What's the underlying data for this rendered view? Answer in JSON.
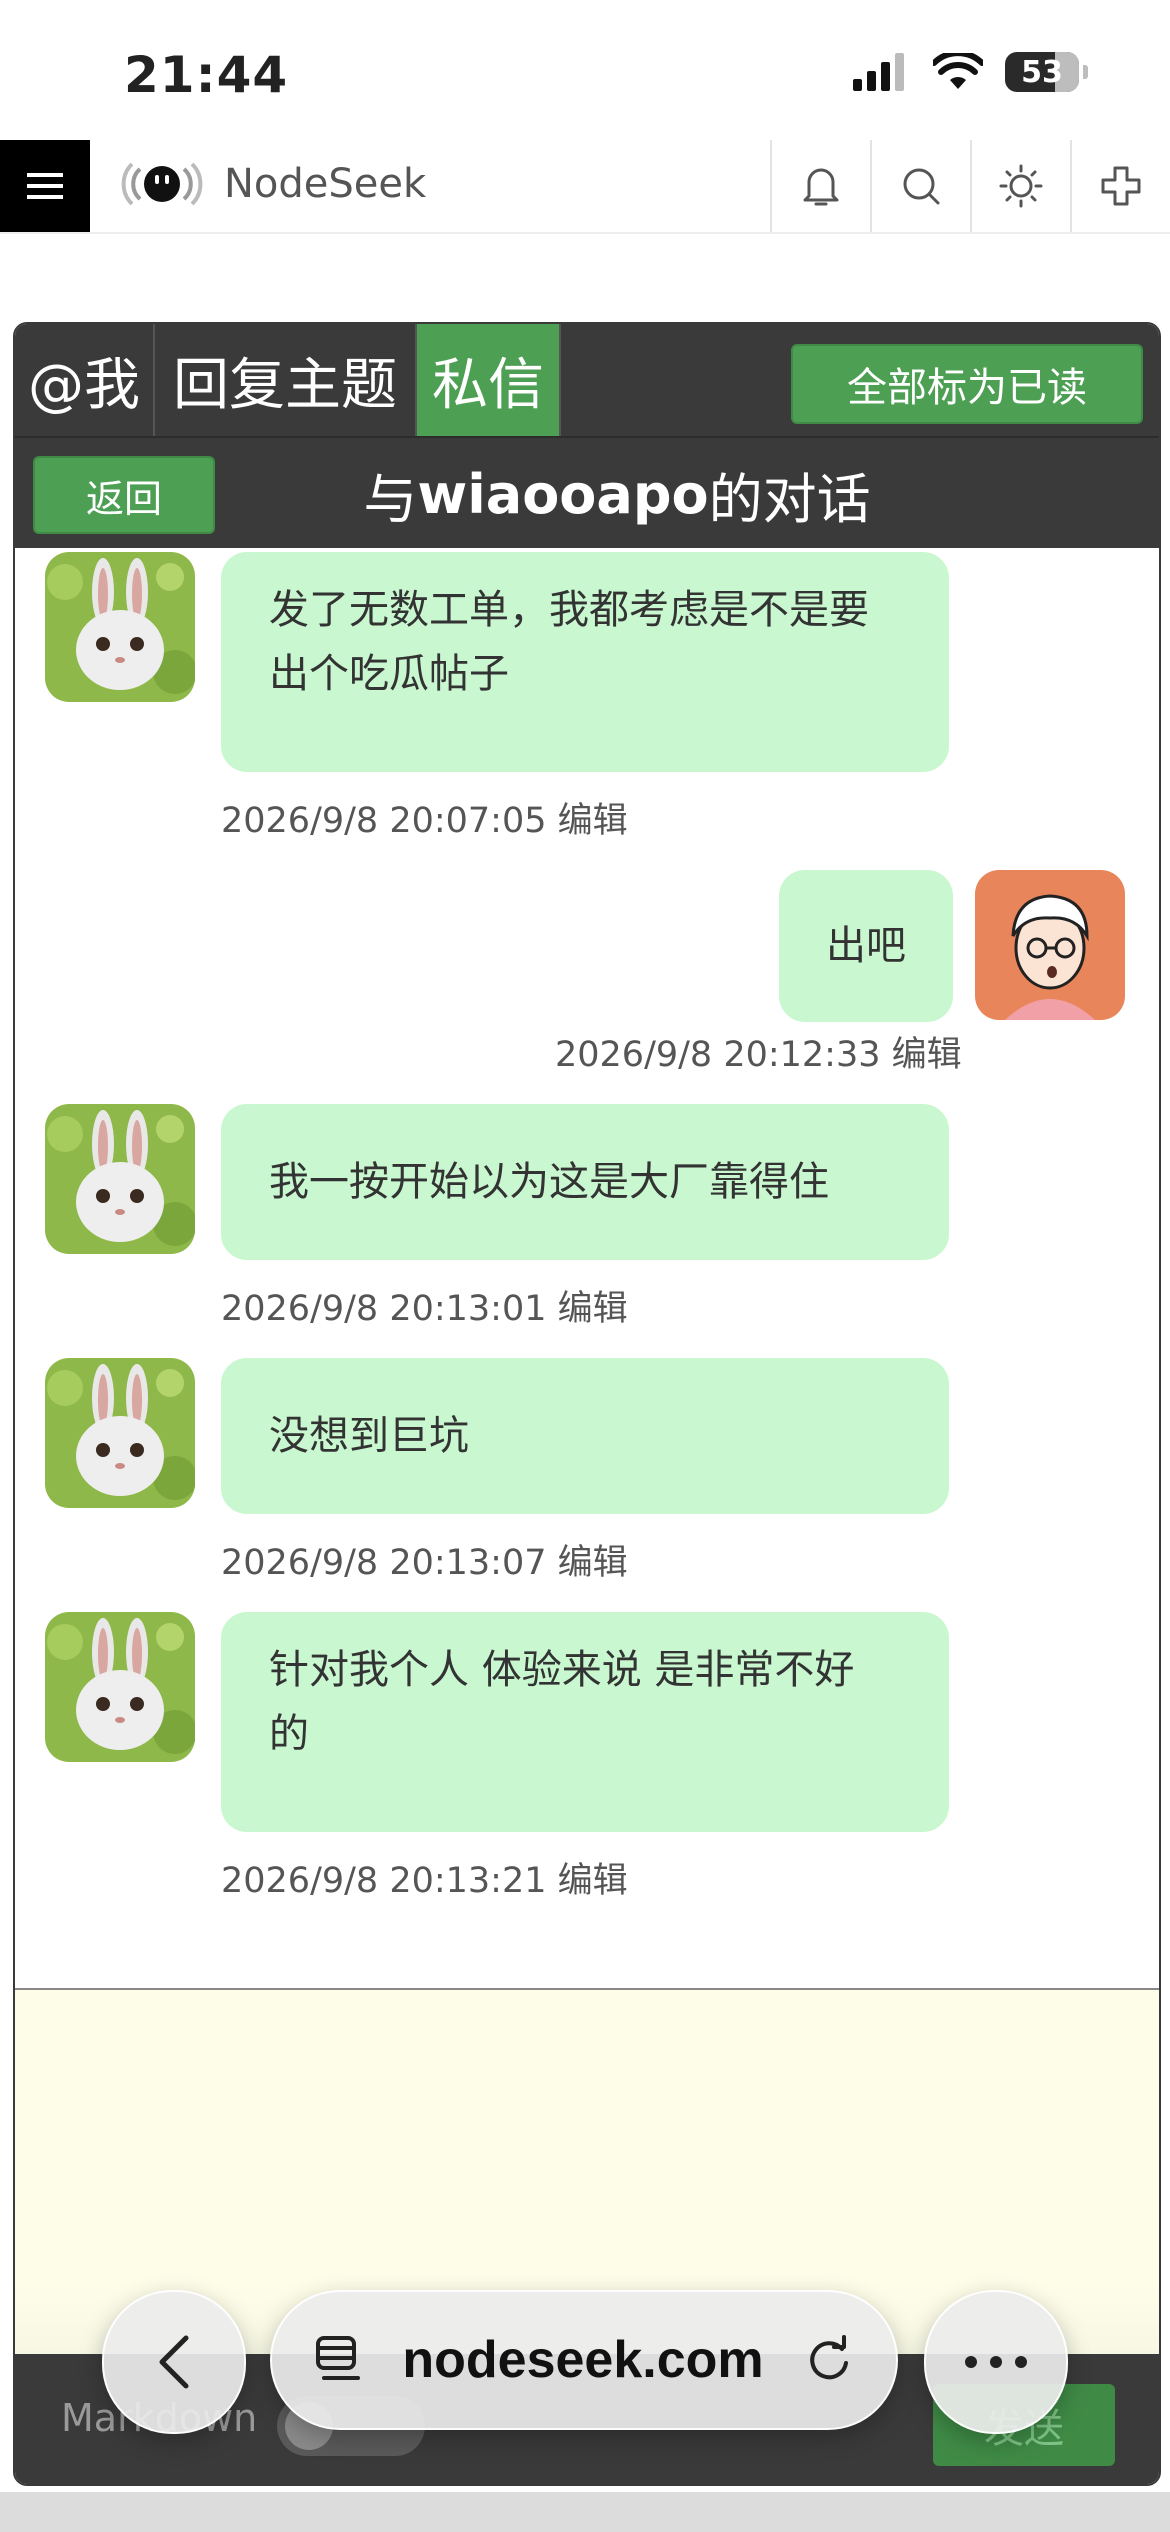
{
  "status_bar": {
    "time": "21:44",
    "battery": "53"
  },
  "site": {
    "name": "NodeSeek"
  },
  "tabs": [
    {
      "label": "@我",
      "active": false
    },
    {
      "label": "回复主题",
      "active": false
    },
    {
      "label": "私信",
      "active": true
    }
  ],
  "mark_all_read": "全部标为已读",
  "conversation": {
    "back_label": "返回",
    "title_prefix": "与",
    "partner": "wiaooapo",
    "title_suffix": "的对话"
  },
  "messages": [
    {
      "side": "left",
      "lines": [
        "发了无数工单，我都考虑是不是要",
        "出个吃瓜帖子"
      ],
      "time": "2026/9/8 20:07:05",
      "edit": "编辑"
    },
    {
      "side": "right",
      "lines": [
        "出吧"
      ],
      "time": "2026/9/8 20:12:33",
      "edit": "编辑"
    },
    {
      "side": "left",
      "lines": [
        "我一按开始以为这是大厂靠得住"
      ],
      "time": "2026/9/8 20:13:01",
      "edit": "编辑"
    },
    {
      "side": "left",
      "lines": [
        "没想到巨坑"
      ],
      "time": "2026/9/8 20:13:07",
      "edit": "编辑"
    },
    {
      "side": "left",
      "lines": [
        "针对我个人 体验来说 是非常不好",
        "的"
      ],
      "time": "2026/9/8 20:13:21",
      "edit": "编辑"
    }
  ],
  "compose": {
    "markdown_label": "Markdown",
    "send_label": "发送"
  },
  "browser": {
    "url": "nodeseek.com"
  },
  "colors": {
    "accent": "#4c9f53",
    "bubble": "#c8f7d0",
    "dark": "#3a3a3a",
    "compose_bg": "#fdfde8"
  }
}
